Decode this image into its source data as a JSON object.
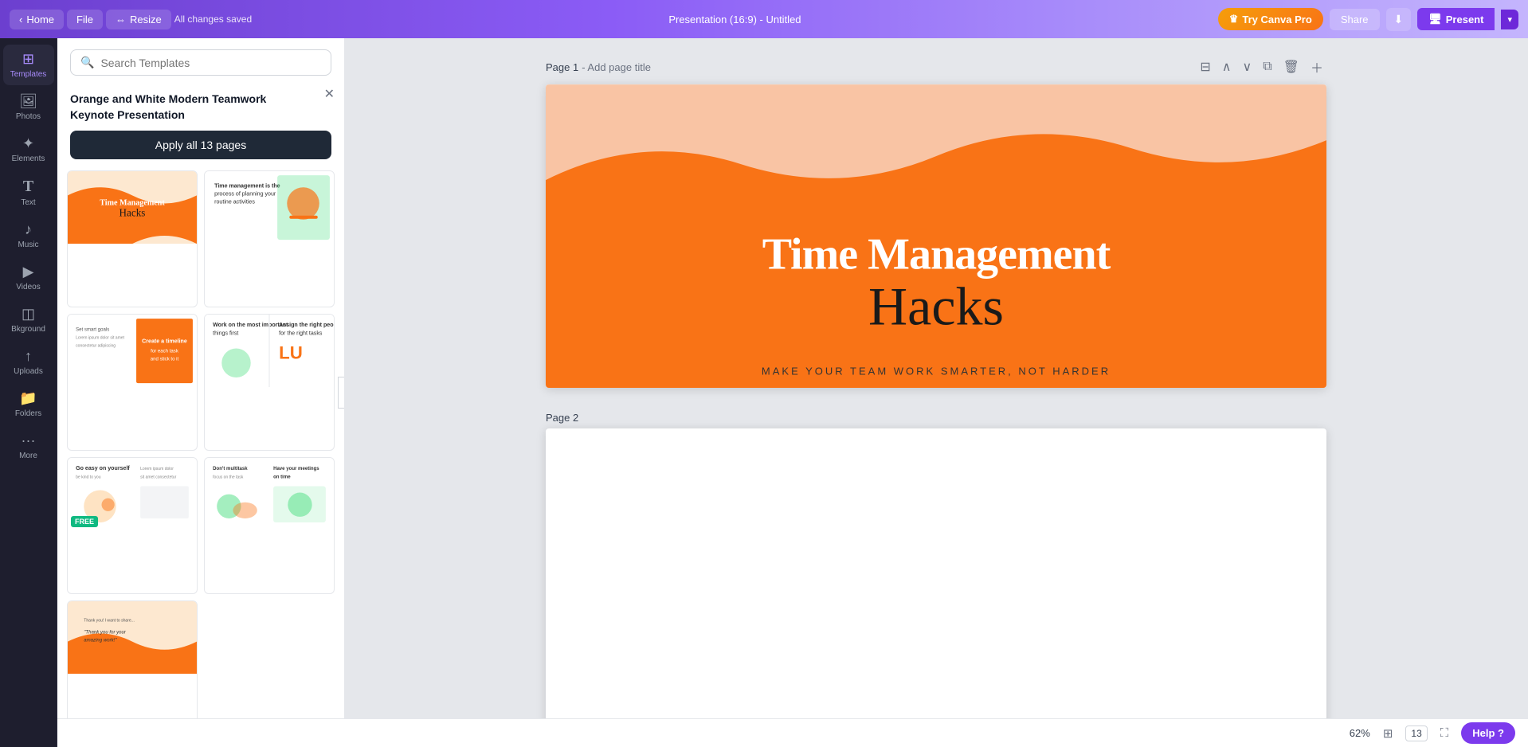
{
  "topnav": {
    "home": "Home",
    "file": "File",
    "resize": "Resize",
    "save_status": "All changes saved",
    "title": "Presentation (16:9) - Untitled",
    "try_pro": "Try Canva Pro",
    "share": "Share",
    "present": "Present"
  },
  "sidebar": {
    "items": [
      {
        "id": "templates",
        "label": "Templates",
        "icon": "⊞"
      },
      {
        "id": "photos",
        "label": "Photos",
        "icon": "🖼"
      },
      {
        "id": "elements",
        "label": "Elements",
        "icon": "✦"
      },
      {
        "id": "text",
        "label": "Text",
        "icon": "T"
      },
      {
        "id": "music",
        "label": "Music",
        "icon": "♪"
      },
      {
        "id": "videos",
        "label": "Videos",
        "icon": "▶"
      },
      {
        "id": "background",
        "label": "Bkground",
        "icon": "◫"
      },
      {
        "id": "uploads",
        "label": "Uploads",
        "icon": "↑"
      },
      {
        "id": "folders",
        "label": "Folders",
        "icon": "📁"
      },
      {
        "id": "more",
        "label": "More",
        "icon": "···"
      }
    ]
  },
  "panel": {
    "search_placeholder": "Search Templates",
    "template_title": "Orange and White Modern Teamwork Keynote Presentation",
    "apply_label": "Apply all 13 pages",
    "close_tooltip": "Close"
  },
  "canvas": {
    "page1_label": "Page 1",
    "page1_link": "- Add page title",
    "page2_label": "Page 2",
    "slide1": {
      "title": "Time Management",
      "script_title": "Hacks",
      "subtitle": "MAKE YOUR TEAM WORK SMARTER, NOT HARDER"
    }
  },
  "bottombar": {
    "zoom": "62%",
    "page_count": "13",
    "help": "Help ?"
  }
}
